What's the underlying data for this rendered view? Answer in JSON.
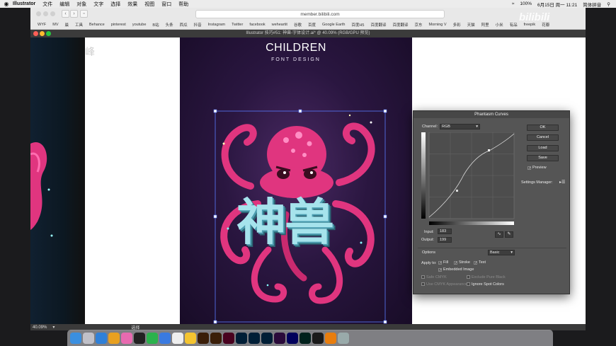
{
  "menubar": {
    "app_name": "Illustrator",
    "items": [
      "文件",
      "编辑",
      "对象",
      "文字",
      "选择",
      "效果",
      "视图",
      "窗口",
      "帮助"
    ],
    "battery": "100%",
    "clock": "6月15日 周一 11:21",
    "input_method": "简体拼音"
  },
  "safari": {
    "url": "member.bilibili.com",
    "bookmarks": [
      "WYF",
      "MV",
      "晨",
      "工具",
      "Behance",
      "pinterest",
      "youtube",
      "B站",
      "头条",
      "西瓜",
      "抖音",
      "Instagram",
      "Twitter",
      "facebook",
      "weheartit",
      "谷歌",
      "百度",
      "Google Earth",
      "百度H5",
      "百度翻译",
      "百度翻译",
      "京东",
      "Morning V",
      "多彩",
      "天猫",
      "阿里",
      "小米",
      "有品",
      "freepik",
      "花瓣"
    ]
  },
  "ai_window": {
    "title": "Illustrator 技巧#51: 神兽-字体设计.ai* @ 40.09% (RGB/GPU 预览)",
    "zoom": "40.09%",
    "status_tool": "选择"
  },
  "artwork": {
    "title": "CHILDREN",
    "subtitle": "FONT DESIGN",
    "chinese": "神兽",
    "bg_fragment_1": "峰"
  },
  "panel": {
    "title": "Phantasm Curves",
    "channel_label": "Channel:",
    "channel_value": "RGB",
    "ok": "OK",
    "cancel": "Cancel",
    "load": "Load",
    "save": "Save",
    "preview": "Preview",
    "settings_manager": "Settings Manager:",
    "input_label": "Input:",
    "input_value": "183",
    "output_label": "Output:",
    "output_value": "199",
    "options_label": "Options",
    "options_mode": "Basic",
    "apply_to": "Apply to:",
    "fill": "Fill",
    "stroke": "Stroke",
    "text": "Text",
    "embedded_image": "Embedded Image",
    "safe_cmyk": "Safe CMYK",
    "exclude_pure_black": "Exclude Pure Black",
    "use_cmyk_appearance": "Use CMYK Appearance",
    "ignore_spot_colors": "Ignore Spot Colors"
  },
  "watermark": "bilibili",
  "colors": {
    "accent_pink": "#e0357f",
    "cyan_text": "#a6e3ec",
    "artboard_purple": "#2a1640"
  },
  "dock": [
    "Finder",
    "Launchpad",
    "Safari",
    "Chrome",
    "Photos",
    "QQ",
    "WeChat",
    "Mail",
    "TextEdit",
    "Notes",
    "Illustrator",
    "Illustrator",
    "InDesign",
    "Photoshop",
    "Photoshop",
    "Lightroom",
    "Premiere",
    "After Effects",
    "Audition",
    "Cinema 4D",
    "Blender",
    "Trash"
  ]
}
